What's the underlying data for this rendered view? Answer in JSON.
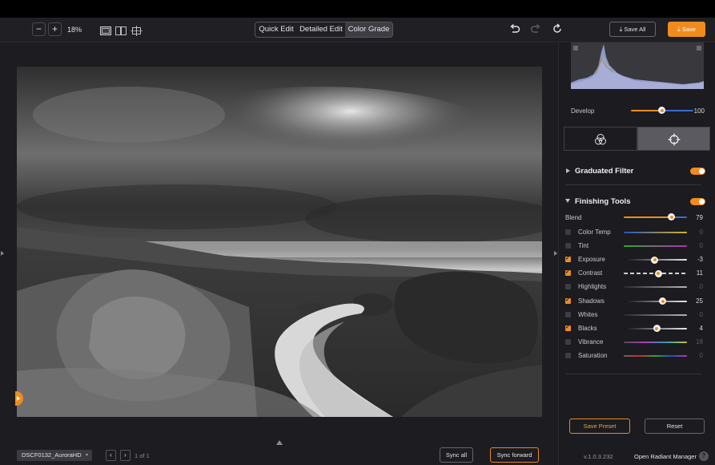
{
  "toolbar": {
    "zoom_out": "−",
    "zoom_in": "+",
    "zoom_level": "18%",
    "modes": [
      {
        "label": "Quick Edit",
        "active": false
      },
      {
        "label": "Detailed Edit",
        "active": false
      },
      {
        "label": "Color Grade",
        "active": true
      }
    ],
    "save_all_label": "Save All",
    "save_label": "Save"
  },
  "bottom_bar": {
    "file_name": "DSCF0132_AuroraHD",
    "pager_prev": "‹",
    "pager_next": "›",
    "pager_text": "1 of 1",
    "sync_all_label": "Sync all",
    "sync_forward_label": "Sync forward"
  },
  "panel": {
    "develop": {
      "label": "Develop",
      "value": "100",
      "level": 0.45
    },
    "graduated_filter": {
      "title": "Graduated Filter",
      "enabled": true
    },
    "finishing_tools": {
      "title": "Finishing Tools",
      "enabled": true,
      "blend": {
        "label": "Blend",
        "value": "79",
        "level": 0.79
      },
      "adjustments": [
        {
          "label": "Color Temp",
          "value": "0",
          "checked": false,
          "level": 0.5
        },
        {
          "label": "Tint",
          "value": "0",
          "checked": false,
          "level": 0.5
        },
        {
          "label": "Exposure",
          "value": "-3",
          "checked": true,
          "level": 0.49
        },
        {
          "label": "Contrast",
          "value": "11",
          "checked": true,
          "level": 0.55
        },
        {
          "label": "Highlights",
          "value": "0",
          "checked": false,
          "level": 0.5
        },
        {
          "label": "Shadows",
          "value": "25",
          "checked": true,
          "level": 0.62
        },
        {
          "label": "Whites",
          "value": "0",
          "checked": false,
          "level": 0.5
        },
        {
          "label": "Blacks",
          "value": "4",
          "checked": true,
          "level": 0.52
        },
        {
          "label": "Vibrance",
          "value": "18",
          "checked": false,
          "level": 0.59
        },
        {
          "label": "Saturation",
          "value": "0",
          "checked": false,
          "level": 0.5
        }
      ]
    },
    "save_preset_label": "Save Preset",
    "reset_label": "Reset",
    "version": "v.1.0.3.232",
    "manager_label": "Open Radiant Manager",
    "help_label": "?"
  },
  "colors": {
    "accent": "#f08c1e",
    "panel_bg": "#1b1b20",
    "canvas_bg": "#1c1c21"
  }
}
